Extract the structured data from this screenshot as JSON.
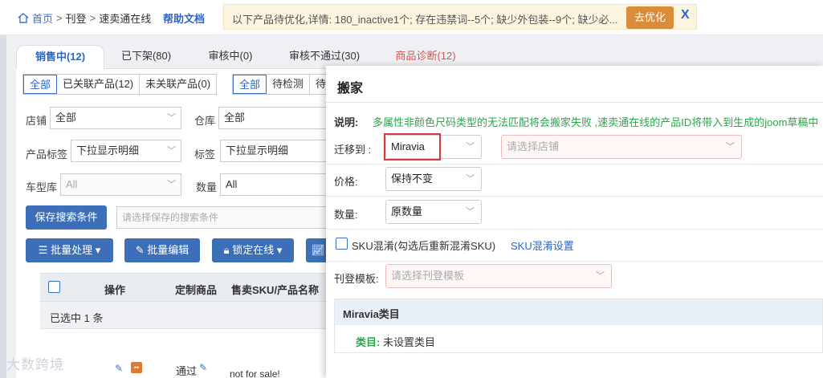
{
  "breadcrumb": {
    "home": "首页",
    "sep": ">",
    "level1": "刊登",
    "level2": "速卖通在线",
    "help": "帮助文档"
  },
  "notice": {
    "text": "以下产品待优化,详情: 180_inactive1个; 存在违禁词--5个; 缺少外包装--9个; 缺少必...",
    "optimize_label": "去优化",
    "close_label": "X"
  },
  "tabs": [
    {
      "label": "销售中(12)"
    },
    {
      "label": "已下架(80)"
    },
    {
      "label": "审核中(0)"
    },
    {
      "label": "审核不通过(30)"
    },
    {
      "label": "商品诊断(12)"
    }
  ],
  "link_filter": [
    "全部",
    "已关联产品(12)",
    "未关联产品(0)"
  ],
  "check_filter": [
    "全部",
    "待检测",
    "待"
  ],
  "filters": {
    "store_label": "店铺",
    "store_value": "全部",
    "warehouse_label": "仓库",
    "warehouse_value": "全部",
    "product_tag_label": "产品标签",
    "product_tag_value": "下拉显示明细",
    "tag_label": "标签",
    "tag_value": "下拉显示明细",
    "car_label": "车型库",
    "car_value": "All",
    "qty_label": "数量",
    "qty_value": "All",
    "save_search": "保存搜索条件",
    "saved_placeholder": "请选择保存的搜索条件"
  },
  "toolbar": {
    "batch": "批量处理",
    "batch_edit": "批量编辑",
    "lock": "锁定在线"
  },
  "table": {
    "headers": [
      "操作",
      "定制商品",
      "售卖SKU/产品名称"
    ],
    "selected_text": "已选中 1 条",
    "pass_text": "通过",
    "not_for_sale": "not for sale!"
  },
  "watermark": "大数跨境",
  "modal": {
    "title": "搬家",
    "note_label": "说明:",
    "note_text": "多属性非颜色尺码类型的无法匹配将会搬家失败 ,速卖通在线的产品ID将带入到生成的joom草稿中",
    "move_to_label": "迁移到 :",
    "move_to_value": "Miravia",
    "store_placeholder": "请选择店铺",
    "price_label": "价格:",
    "price_value": "保持不变",
    "qty_label": "数量:",
    "qty_value": "原数量",
    "sku_label": "SKU混淆(勾选后重新混淆SKU)",
    "sku_settings": "SKU混淆设置",
    "template_label": "刊登模板:",
    "template_placeholder": "请选择刊登模板",
    "category_title": "Miravia类目",
    "category_key": "类目:",
    "category_value": "未设置类目"
  },
  "colors": {
    "primary": "#3d6fb8",
    "link": "#2b66c6",
    "success": "#2ea44f",
    "warning_btn": "#d98c3a",
    "danger": "#d63b3b"
  }
}
